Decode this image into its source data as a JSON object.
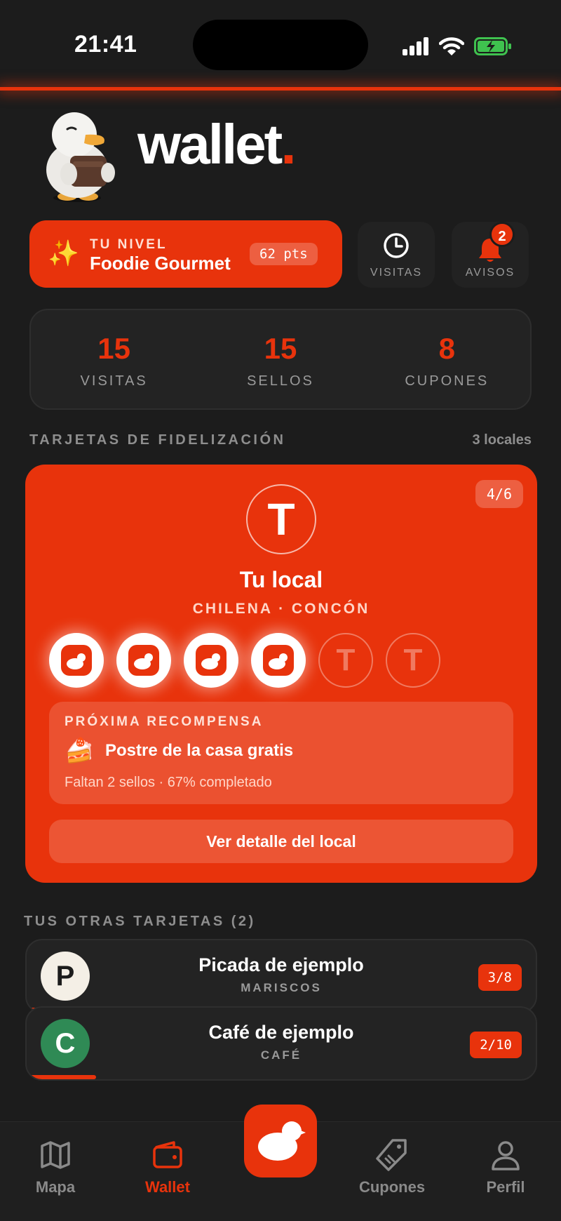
{
  "status_bar": {
    "time": "21:41"
  },
  "header": {
    "brand": "wallet",
    "brand_dot": "."
  },
  "level": {
    "caption": "TU NIVEL",
    "name": "Foodie Gourmet",
    "points": "62 pts"
  },
  "quick_actions": {
    "visits_label": "VISITAS",
    "alerts_label": "AVISOS",
    "alerts_badge": "2"
  },
  "stats": [
    {
      "value": "15",
      "label": "VISITAS"
    },
    {
      "value": "15",
      "label": "SELLOS"
    },
    {
      "value": "8",
      "label": "CUPONES"
    }
  ],
  "loyalty_section": {
    "title": "TARJETAS DE FIDELIZACIÓN",
    "count": "3 locales"
  },
  "featured_card": {
    "progress_label": "4/6",
    "avatar_letter": "T",
    "name": "Tu local",
    "subtitle": "CHILENA · CONCÓN",
    "stamps_filled": 4,
    "stamps_total": 6,
    "empty_stamp_letter": "T",
    "reward": {
      "caption": "PRÓXIMA RECOMPENSA",
      "emoji": "🍰",
      "title": "Postre de la casa gratis",
      "meta": "Faltan 2 sellos · 67% completado"
    },
    "detail_button": "Ver detalle del local"
  },
  "other_cards": {
    "title": "TUS OTRAS TARJETAS (2)",
    "items": [
      {
        "letter": "P",
        "name": "Picada de ejemplo",
        "category": "MARISCOS",
        "progress_label": "3/8",
        "progress": 0.375,
        "avatar_bg": "#f4efe6",
        "avatar_fg": "#1c1c1c"
      },
      {
        "letter": "C",
        "name": "Café de ejemplo",
        "category": "CAFÉ",
        "progress_label": "2/10",
        "progress": 0.2,
        "avatar_bg": "#2f8a55",
        "avatar_fg": "#ffffff"
      }
    ]
  },
  "nav": {
    "items": [
      {
        "label": "Mapa",
        "icon": "map-icon"
      },
      {
        "label": "Wallet",
        "icon": "wallet-icon",
        "active": true
      },
      {
        "label": "Cupones",
        "icon": "tag-icon"
      },
      {
        "label": "Perfil",
        "icon": "user-icon"
      }
    ],
    "center_icon": "duck-icon"
  },
  "colors": {
    "accent": "#e8330c",
    "background": "#1c1c1c",
    "card": "#232323"
  }
}
